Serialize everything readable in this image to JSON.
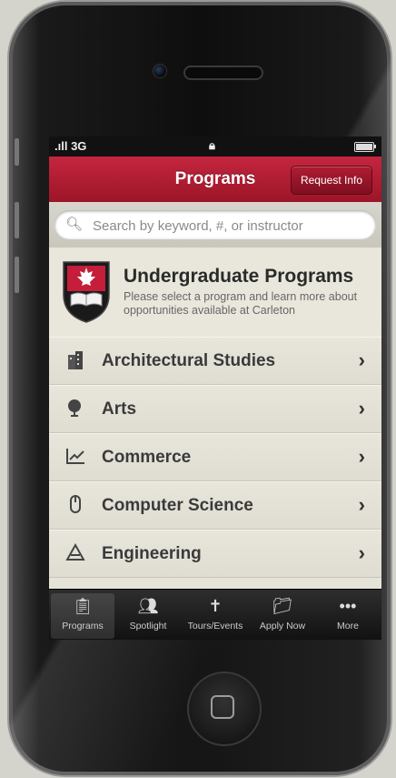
{
  "status": {
    "carrier": "3G"
  },
  "navbar": {
    "title": "Programs",
    "request_label": "Request Info"
  },
  "search": {
    "placeholder": "Search by keyword, #, or instructor"
  },
  "header": {
    "title": "Undergraduate Programs",
    "description": "Please select a program and learn more about opportunities available at Carleton"
  },
  "programs": [
    {
      "label": "Architectural Studies",
      "icon": "building-icon"
    },
    {
      "label": "Arts",
      "icon": "globe-icon"
    },
    {
      "label": "Commerce",
      "icon": "chart-icon"
    },
    {
      "label": "Computer Science",
      "icon": "mouse-icon"
    },
    {
      "label": "Engineering",
      "icon": "tools-icon"
    }
  ],
  "tabs": [
    {
      "label": "Programs",
      "icon": "clipboard-icon",
      "active": true
    },
    {
      "label": "Spotlight",
      "icon": "people-icon",
      "active": false
    },
    {
      "label": "Tours/Events",
      "icon": "signpost-icon",
      "active": false
    },
    {
      "label": "Apply Now",
      "icon": "folder-icon",
      "active": false
    },
    {
      "label": "More",
      "icon": "more-icon",
      "active": false
    }
  ],
  "colors": {
    "accent": "#b01c33",
    "background": "#e6e4d9"
  }
}
